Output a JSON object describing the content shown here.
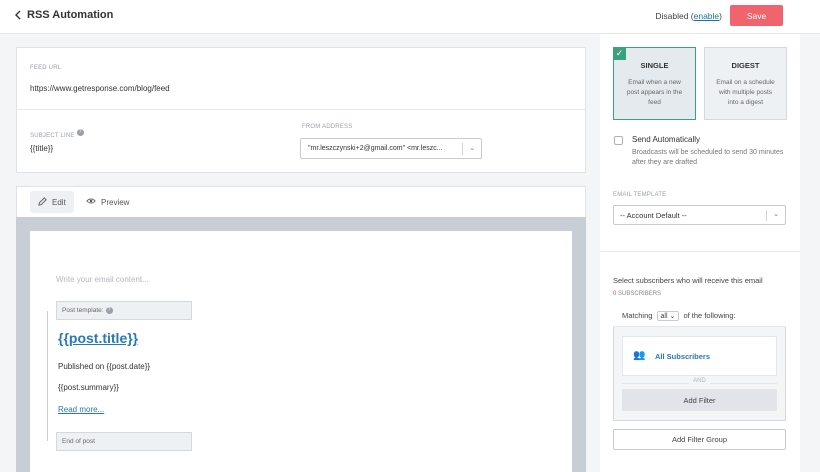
{
  "header": {
    "title": "RSS Automation",
    "status_text": "Disabled",
    "enable_link": "enable",
    "save_label": "Save"
  },
  "feed": {
    "url_label": "FEED URL",
    "url_value": "https://www.getresponse.com/blog/feed",
    "subject_label": "SUBJECT LINE",
    "subject_value": "{{title}}",
    "from_label": "FROM ADDRESS",
    "from_value": "\"mr.leszczynski+2@gmail.com\" <mr.leszc..."
  },
  "editor": {
    "tabs": [
      {
        "label": "Edit",
        "icon": "pencil-icon"
      },
      {
        "label": "Preview",
        "icon": "eye-icon"
      }
    ],
    "placeholder": "Write your email content...",
    "post_template_label": "Post template:",
    "post_title": "{{post.title}}",
    "published_line": "Published on {{post.date}}",
    "summary_line": "{{post.summary}}",
    "read_more": "Read more...",
    "end_of_post": "End of post"
  },
  "sidebar": {
    "single": {
      "title": "SINGLE",
      "desc": "Email when a new post appears in the feed",
      "selected": true
    },
    "digest": {
      "title": "DIGEST",
      "desc": "Email on a schedule with multiple posts into a digest",
      "selected": false
    },
    "send_auto_title": "Send Automatically",
    "send_auto_desc": "Broadcasts will be scheduled to send 30 minutes after they are drafted",
    "template_label": "EMAIL TEMPLATE",
    "template_value": "-- Account Default --",
    "select_info": "Select subscribers who will receive this email",
    "subs_count": "0",
    "subs_label": "SUBSCRIBERS",
    "matching_prefix": "Matching",
    "matching_value": "all",
    "matching_suffix": "of the following:",
    "all_subscribers": "All Subscribers",
    "and_label": "AND",
    "add_filter": "Add Filter",
    "add_filter_group": "Add Filter Group"
  },
  "colors": {
    "accent": "#f0646d",
    "link": "#2779b4",
    "selected_green": "#3aa17e"
  }
}
